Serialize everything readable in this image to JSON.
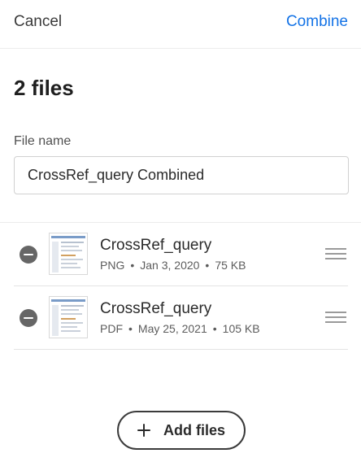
{
  "header": {
    "cancel_label": "Cancel",
    "combine_label": "Combine"
  },
  "title": "2 files",
  "file_name": {
    "label": "File name",
    "value": "CrossRef_query Combined"
  },
  "files": [
    {
      "name": "CrossRef_query",
      "type": "PNG",
      "date": "Jan 3, 2020",
      "size": "75 KB",
      "separator": "•"
    },
    {
      "name": "CrossRef_query",
      "type": "PDF",
      "date": "May 25, 2021",
      "size": "105 KB",
      "separator": "•"
    }
  ],
  "add_files_label": "Add files",
  "colors": {
    "accent": "#1473e6",
    "remove_icon": "#666666"
  },
  "icons": {
    "remove": "minus-circle-icon",
    "drag": "drag-handle-icon",
    "add": "plus-icon"
  }
}
